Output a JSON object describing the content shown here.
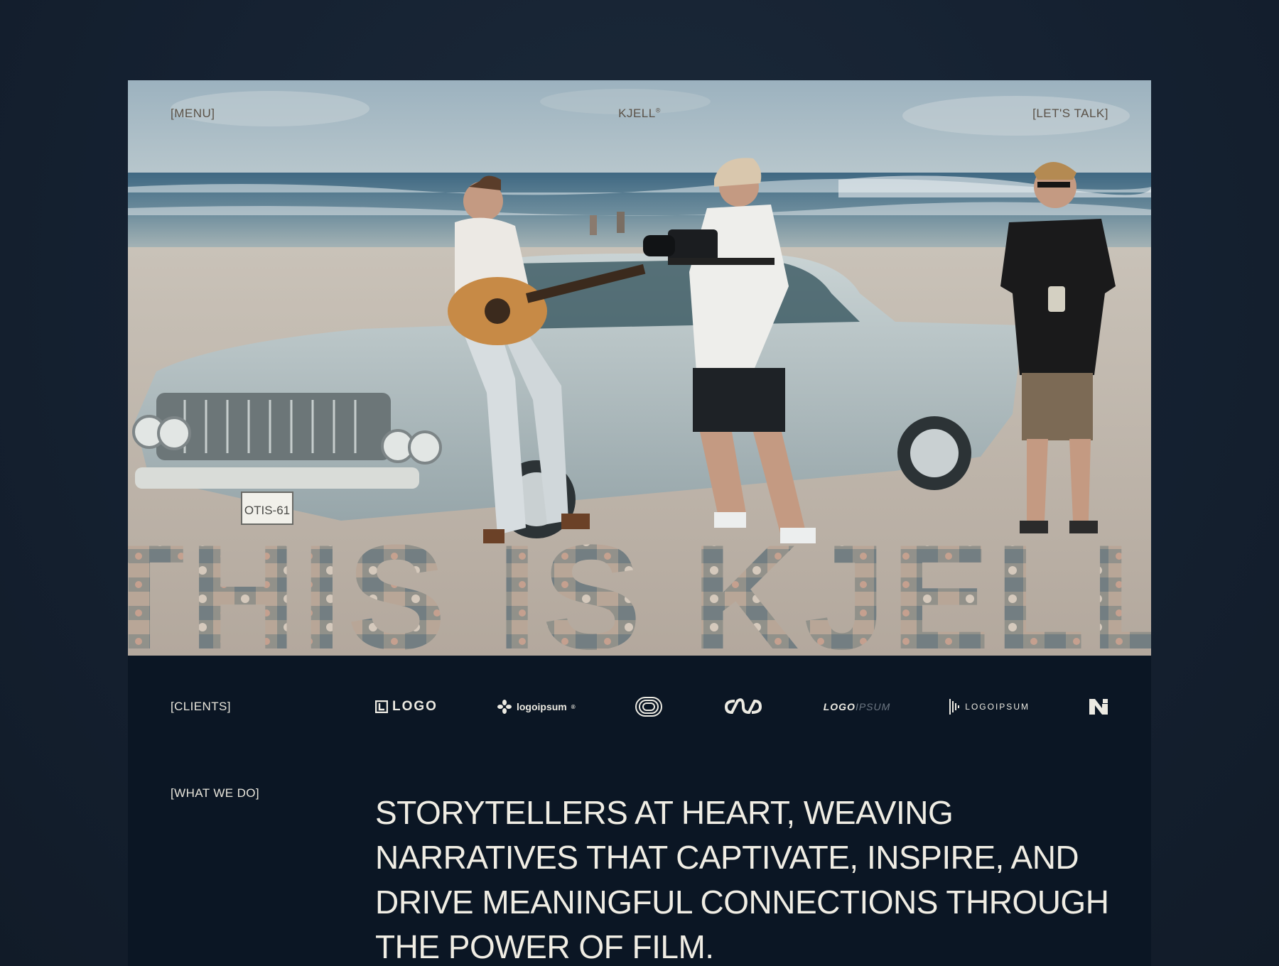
{
  "nav": {
    "menu_label": "[MENU]",
    "brand": "KJELL",
    "brand_mark": "®",
    "cta_label": "[LET'S TALK]"
  },
  "hero": {
    "headline": "THIS IS KJELL",
    "photo_description_icon": "photo-scene",
    "plate_text": "OTIS-61"
  },
  "clients": {
    "label": "[CLIENTS]",
    "logos": [
      {
        "text": "LOGO",
        "icon": "square-l-icon"
      },
      {
        "text": "logoipsum",
        "mark": "®",
        "icon": "flower-icon"
      },
      {
        "text": "",
        "icon": "concentric-rounded-icon"
      },
      {
        "text": "",
        "icon": "chain-loop-icon"
      },
      {
        "text_main": "LOGO",
        "text_dim": "IPSUM",
        "icon": ""
      },
      {
        "text": "LOGOIPSUM",
        "icon": "bars-icon"
      },
      {
        "text": "",
        "icon": "n-mark-icon"
      }
    ]
  },
  "what_we_do": {
    "label": "[WHAT WE DO]",
    "statement": "STORYTELLERS AT HEART, WEAVING NARRATIVES THAT CAPTIVATE, INSPIRE, AND DRIVE MEANINGFUL CONNECTIONS THROUGH THE POWER OF FILM."
  },
  "colors": {
    "page_bg": "#152131",
    "panel_bg": "#0b1624",
    "text_light": "#f0ede4",
    "nav_text": "#5a5147"
  }
}
